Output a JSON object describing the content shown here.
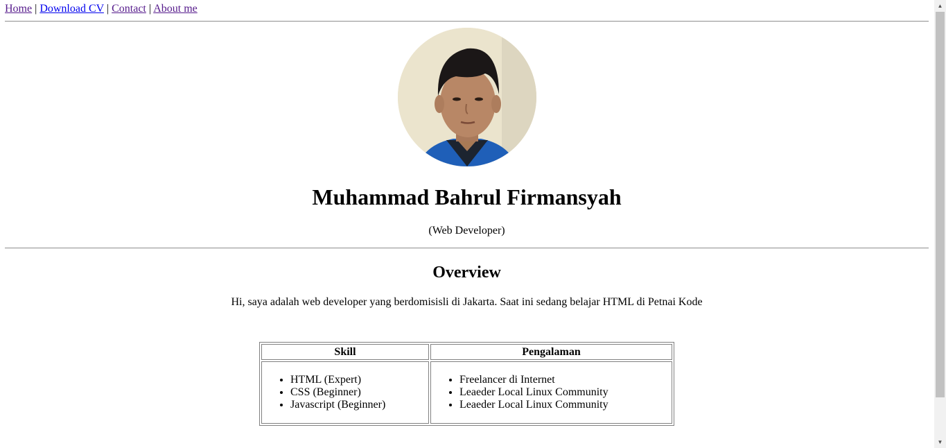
{
  "nav": {
    "links": [
      {
        "label": "Home"
      },
      {
        "label": "Download CV"
      },
      {
        "label": "Contact"
      },
      {
        "label": "About me"
      }
    ],
    "separator": "|"
  },
  "profile": {
    "name": "Muhammad Bahrul Firmansyah",
    "role": "(Web Developer)",
    "photo_icon": "profile-photo"
  },
  "overview": {
    "heading": "Overview",
    "text": "Hi, saya adalah web developer yang berdomisisli di Jakarta. Saat ini sedang belajar HTML di Petnai Kode"
  },
  "table": {
    "headers": [
      "Skill",
      "Pengalaman"
    ],
    "skills": [
      "HTML (Expert)",
      "CSS (Beginner)",
      "Javascript (Beginner)"
    ],
    "experience": [
      "Freelancer di Internet",
      "Leaeder Local Linux Community",
      "Leaeder Local Linux Community"
    ]
  },
  "colors": {
    "link": "#0000ee",
    "visited_link": "#551a8b",
    "border": "#808080",
    "scrollbar_track": "#f1f1f1",
    "scrollbar_thumb": "#c1c1c1"
  }
}
